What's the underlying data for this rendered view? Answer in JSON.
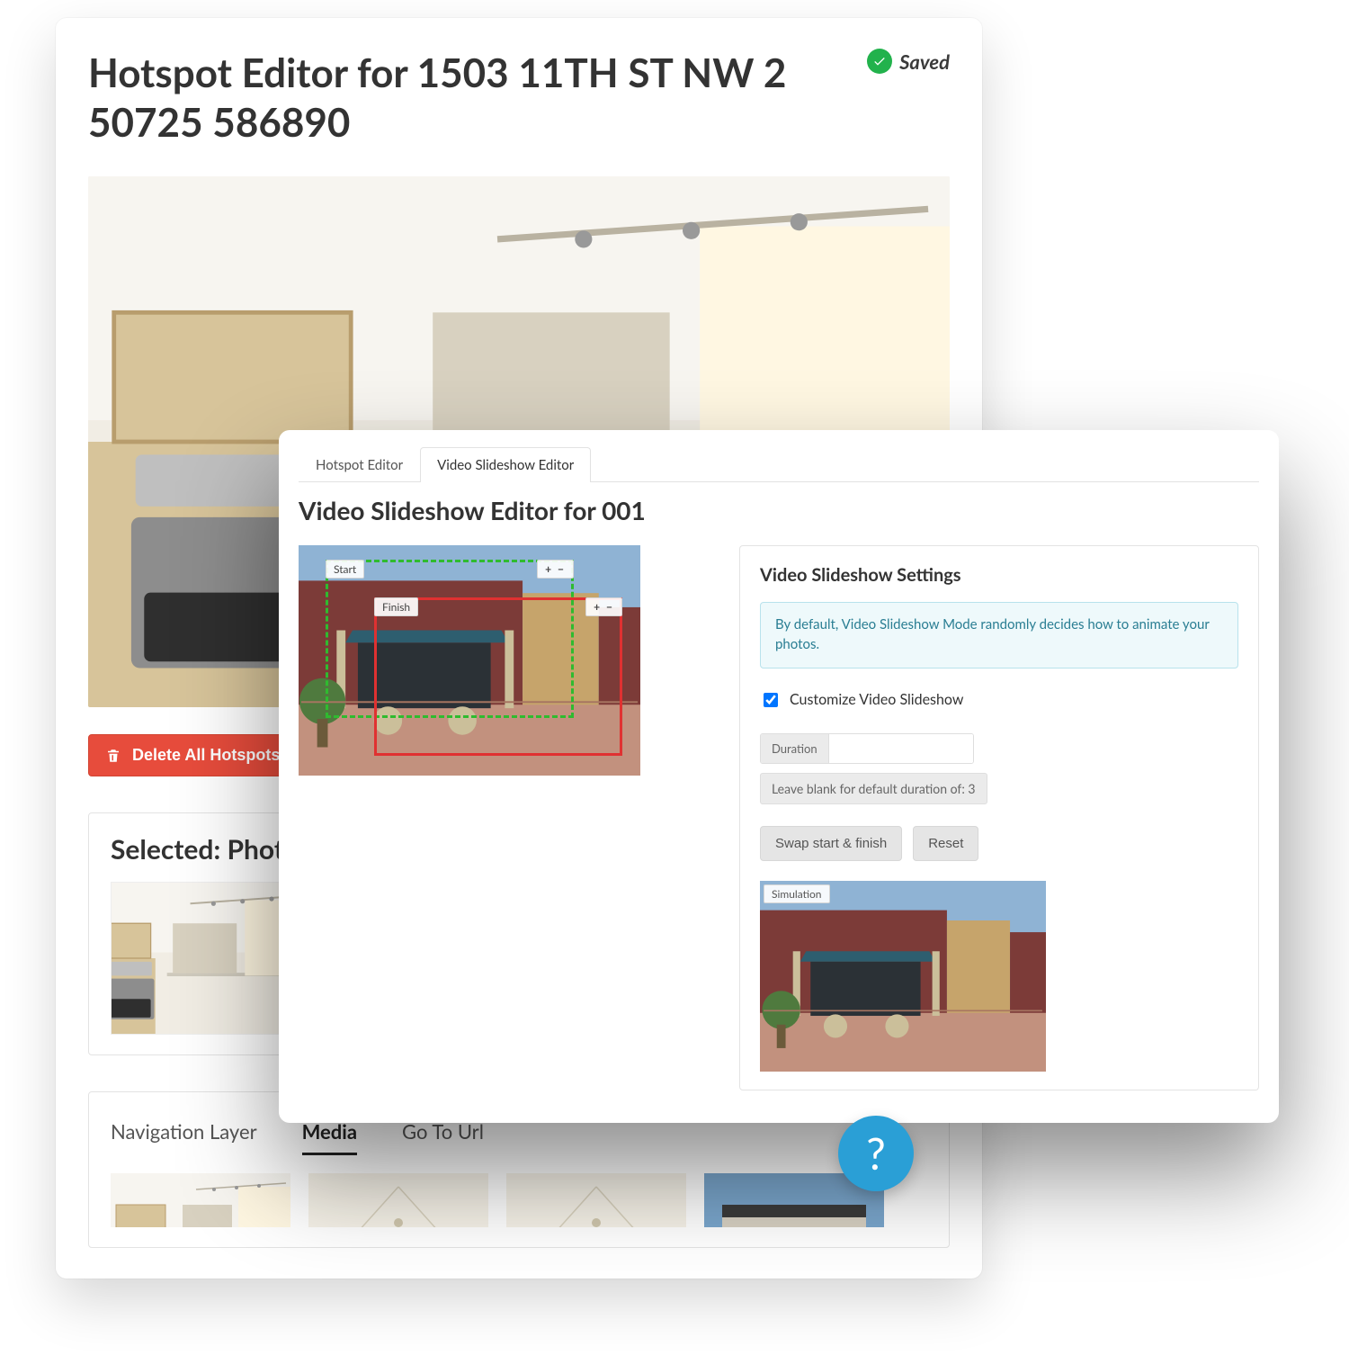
{
  "hotspot": {
    "title": "Hotspot Editor for 1503 11TH ST NW 2 50725 586890",
    "save_status": "Saved",
    "delete_label": "Delete All Hotspots",
    "selected_title": "Selected: Photo",
    "tabs": [
      {
        "label": "Navigation Layer"
      },
      {
        "label": "Media"
      },
      {
        "label": "Go To Url"
      }
    ]
  },
  "slideshow": {
    "tabs": [
      {
        "label": "Hotspot Editor"
      },
      {
        "label": "Video Slideshow Editor"
      }
    ],
    "title": "Video Slideshow Editor for 001",
    "frame_start": "Start",
    "frame_finish": "Finish",
    "frame_pm": "+ −",
    "settings_title": "Video Slideshow Settings",
    "info": "By default, Video Slideshow Mode randomly decides how to animate your photos.",
    "customize_label": "Customize Video Slideshow",
    "customize_checked": true,
    "duration_label": "Duration",
    "duration_value": "",
    "duration_hint": "Leave blank for default duration of: 3",
    "swap_label": "Swap start & finish",
    "reset_label": "Reset",
    "simulation_label": "Simulation"
  },
  "help_symbol": "?"
}
